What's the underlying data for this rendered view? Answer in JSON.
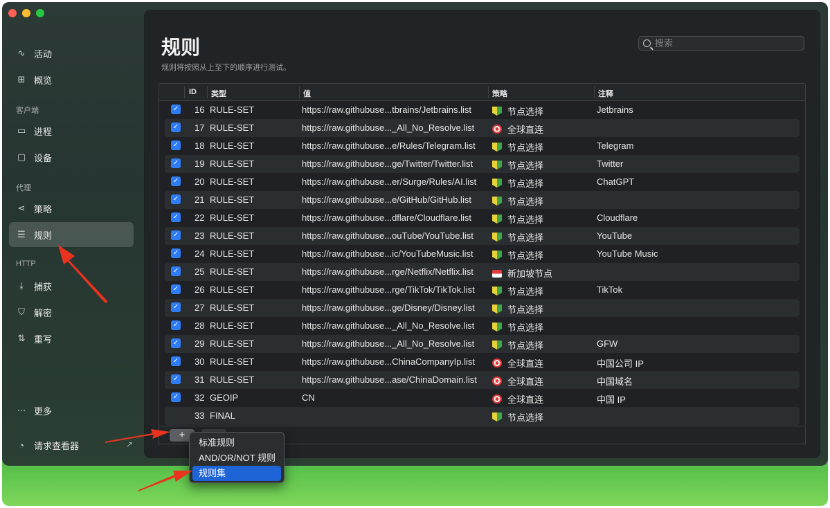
{
  "window": {
    "traffic_lights": [
      "close",
      "minimize",
      "zoom"
    ]
  },
  "sidebar": {
    "items_top": [
      {
        "label": "活动",
        "icon": "activity-icon"
      },
      {
        "label": "概览",
        "icon": "grid-icon"
      }
    ],
    "section_client": "客户端",
    "items_client": [
      {
        "label": "进程",
        "icon": "process-icon"
      },
      {
        "label": "设备",
        "icon": "monitor-icon"
      }
    ],
    "section_proxy": "代理",
    "items_proxy": [
      {
        "label": "策略",
        "icon": "share-icon"
      },
      {
        "label": "规则",
        "icon": "list-check-icon",
        "active": true
      }
    ],
    "section_http": "HTTP",
    "items_http": [
      {
        "label": "捕获",
        "icon": "capture-icon"
      },
      {
        "label": "解密",
        "icon": "shield-icon"
      },
      {
        "label": "重写",
        "icon": "rewrite-icon"
      }
    ],
    "more": "更多",
    "request_viewer": "请求查看器"
  },
  "main": {
    "title": "规则",
    "subtitle": "规则将按照从上至下的顺序进行测试。",
    "search_placeholder": "搜索"
  },
  "table": {
    "headers": {
      "id": "ID",
      "type": "类型",
      "value": "值",
      "policy": "策略",
      "note": "注释"
    },
    "rows": [
      {
        "checked": true,
        "id": "16",
        "type": "RULE-SET",
        "value": "https://raw.githubuse...tbrains/Jetbrains.list",
        "policy": "节点选择",
        "policy_icon": "leaf",
        "note": "Jetbrains"
      },
      {
        "checked": true,
        "id": "17",
        "type": "RULE-SET",
        "value": "https://raw.githubuse..._All_No_Resolve.list",
        "policy": "全球直连",
        "policy_icon": "target",
        "note": ""
      },
      {
        "checked": true,
        "id": "18",
        "type": "RULE-SET",
        "value": "https://raw.githubuse...e/Rules/Telegram.list",
        "policy": "节点选择",
        "policy_icon": "leaf",
        "note": "Telegram"
      },
      {
        "checked": true,
        "id": "19",
        "type": "RULE-SET",
        "value": "https://raw.githubuse...ge/Twitter/Twitter.list",
        "policy": "节点选择",
        "policy_icon": "leaf",
        "note": "Twitter"
      },
      {
        "checked": true,
        "id": "20",
        "type": "RULE-SET",
        "value": "https://raw.githubuse...er/Surge/Rules/AI.list",
        "policy": "节点选择",
        "policy_icon": "leaf",
        "note": "ChatGPT"
      },
      {
        "checked": true,
        "id": "21",
        "type": "RULE-SET",
        "value": "https://raw.githubuse...e/GitHub/GitHub.list",
        "policy": "节点选择",
        "policy_icon": "leaf",
        "note": ""
      },
      {
        "checked": true,
        "id": "22",
        "type": "RULE-SET",
        "value": "https://raw.githubuse...dflare/Cloudflare.list",
        "policy": "节点选择",
        "policy_icon": "leaf",
        "note": "Cloudflare"
      },
      {
        "checked": true,
        "id": "23",
        "type": "RULE-SET",
        "value": "https://raw.githubuse...ouTube/YouTube.list",
        "policy": "节点选择",
        "policy_icon": "leaf",
        "note": "YouTube"
      },
      {
        "checked": true,
        "id": "24",
        "type": "RULE-SET",
        "value": "https://raw.githubuse...ic/YouTubeMusic.list",
        "policy": "节点选择",
        "policy_icon": "leaf",
        "note": "YouTube Music"
      },
      {
        "checked": true,
        "id": "25",
        "type": "RULE-SET",
        "value": "https://raw.githubuse...rge/Netflix/Netflix.list",
        "policy": "新加坡节点",
        "policy_icon": "sg",
        "note": ""
      },
      {
        "checked": true,
        "id": "26",
        "type": "RULE-SET",
        "value": "https://raw.githubuse...rge/TikTok/TikTok.list",
        "policy": "节点选择",
        "policy_icon": "leaf",
        "note": "TikTok"
      },
      {
        "checked": true,
        "id": "27",
        "type": "RULE-SET",
        "value": "https://raw.githubuse...ge/Disney/Disney.list",
        "policy": "节点选择",
        "policy_icon": "leaf",
        "note": ""
      },
      {
        "checked": true,
        "id": "28",
        "type": "RULE-SET",
        "value": "https://raw.githubuse..._All_No_Resolve.list",
        "policy": "节点选择",
        "policy_icon": "leaf",
        "note": ""
      },
      {
        "checked": true,
        "id": "29",
        "type": "RULE-SET",
        "value": "https://raw.githubuse..._All_No_Resolve.list",
        "policy": "节点选择",
        "policy_icon": "leaf",
        "note": "GFW"
      },
      {
        "checked": true,
        "id": "30",
        "type": "RULE-SET",
        "value": "https://raw.githubuse...ChinaCompanyIp.list",
        "policy": "全球直连",
        "policy_icon": "target",
        "note": "中国公司 IP"
      },
      {
        "checked": true,
        "id": "31",
        "type": "RULE-SET",
        "value": "https://raw.githubuse...ase/ChinaDomain.list",
        "policy": "全球直连",
        "policy_icon": "target",
        "note": "中国域名"
      },
      {
        "checked": true,
        "id": "32",
        "type": "GEOIP",
        "value": "CN",
        "policy": "全球直连",
        "policy_icon": "target",
        "note": "中国 IP"
      },
      {
        "checked": false,
        "id": "33",
        "type": "FINAL",
        "value": "",
        "policy": "节点选择",
        "policy_icon": "leaf",
        "note": ""
      }
    ]
  },
  "footer": {
    "add_label": "+"
  },
  "add_menu": {
    "items": [
      "标准规则",
      "AND/OR/NOT 规则",
      "规则集"
    ],
    "selected_index": 2
  },
  "colors": {
    "accent": "#2f7df6",
    "annotation_arrow": "#e8331f",
    "menu_highlight": "#1e64d6"
  }
}
